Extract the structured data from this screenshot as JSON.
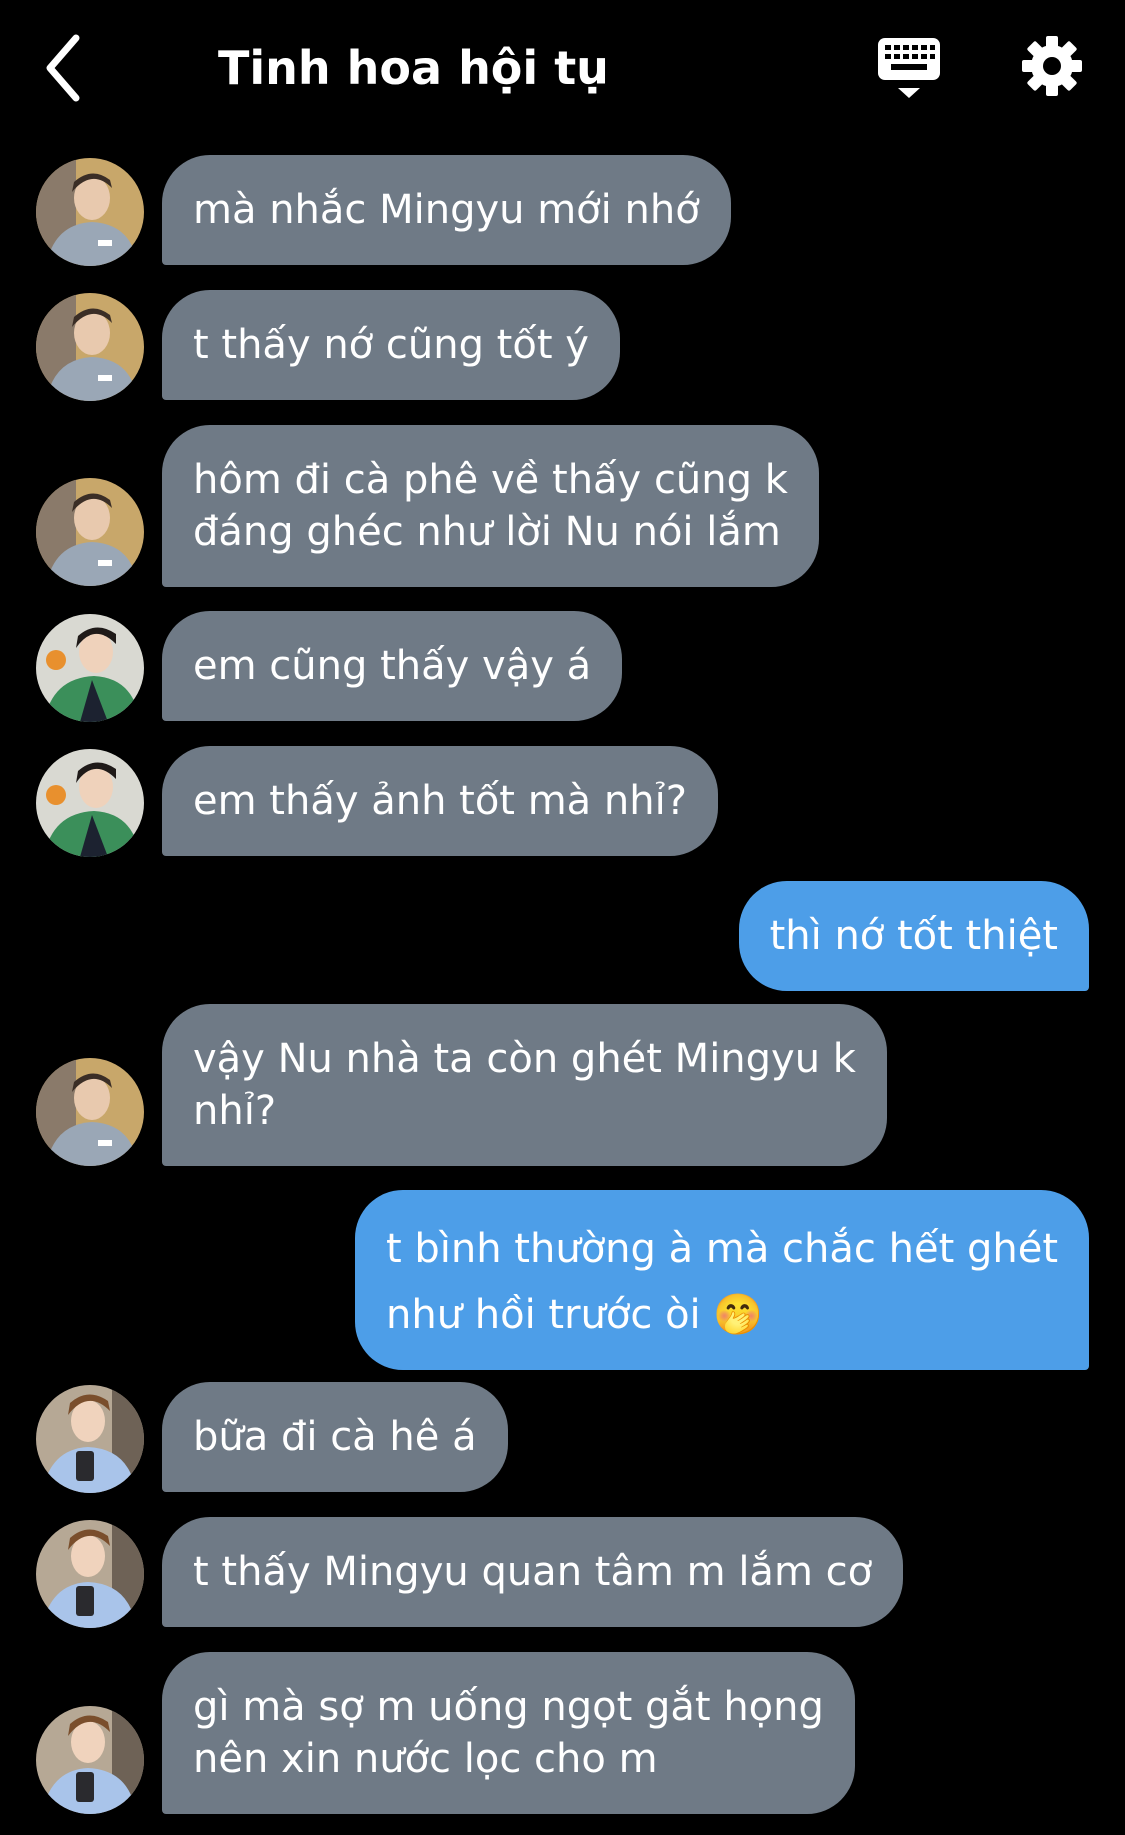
{
  "header": {
    "title": "Tinh hoa hội tụ",
    "back_icon": "chevron-left-icon",
    "keyboard_icon": "keyboard-icon",
    "settings_icon": "gear-icon"
  },
  "colors": {
    "background": "#000000",
    "incoming_bubble": "#6f7a86",
    "outgoing_bubble": "#4d9ee8",
    "text": "#ffffff"
  },
  "messages": [
    {
      "direction": "incoming",
      "sender_avatar": "avatar-gray-hoodie",
      "lines": [
        "mà nhắc Mingyu mới nhớ"
      ]
    },
    {
      "direction": "incoming",
      "sender_avatar": "avatar-gray-hoodie",
      "lines": [
        "t thấy nớ cũng tốt ý"
      ]
    },
    {
      "direction": "incoming",
      "sender_avatar": "avatar-gray-hoodie",
      "lines": [
        "hôm đi cà phê về thấy cũng k",
        "đáng ghéc như lời Nu nói lắm"
      ]
    },
    {
      "direction": "incoming",
      "sender_avatar": "avatar-green-jacket",
      "lines": [
        "em cũng thấy vậy á"
      ]
    },
    {
      "direction": "incoming",
      "sender_avatar": "avatar-green-jacket",
      "lines": [
        "em thấy ảnh tốt mà nhỉ?"
      ]
    },
    {
      "direction": "outgoing",
      "lines": [
        "thì nớ tốt thiệt"
      ]
    },
    {
      "direction": "incoming",
      "sender_avatar": "avatar-gray-hoodie",
      "lines": [
        "vậy Nu nhà ta còn ghét Mingyu k",
        "nhỉ?"
      ]
    },
    {
      "direction": "outgoing",
      "lines": [
        "t bình thường à mà chắc hết ghét",
        "như hồi trước òi 🤭"
      ]
    },
    {
      "direction": "incoming",
      "sender_avatar": "avatar-blue-shirt",
      "lines": [
        "bữa đi cà hê á"
      ]
    },
    {
      "direction": "incoming",
      "sender_avatar": "avatar-blue-shirt",
      "lines": [
        "t thấy Mingyu quan tâm m lắm cơ"
      ]
    },
    {
      "direction": "incoming",
      "sender_avatar": "avatar-blue-shirt",
      "lines": [
        "gì mà sợ m uống ngọt gắt họng",
        "nên xin nước lọc cho m"
      ]
    }
  ]
}
